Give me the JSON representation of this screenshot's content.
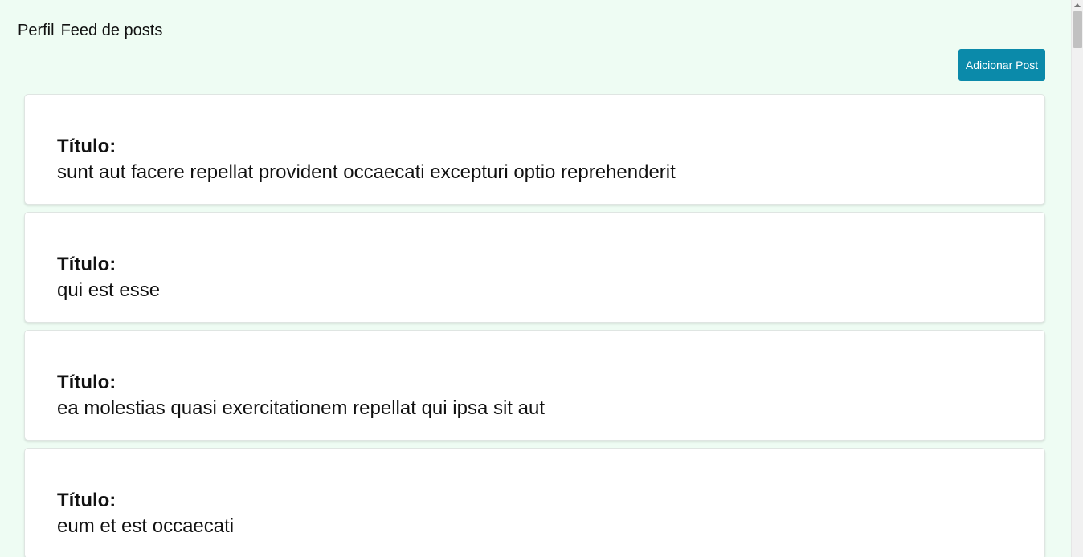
{
  "nav": {
    "profile_label": "Perfil",
    "feed_label": "Feed de posts"
  },
  "toolbar": {
    "add_post_label": "Adicionar Post"
  },
  "colors": {
    "page_background": "#eefcf3",
    "button_background": "#0b8aaa"
  },
  "posts": [
    {
      "label": "Título:",
      "title": "sunt aut facere repellat provident occaecati excepturi optio reprehenderit"
    },
    {
      "label": "Título:",
      "title": "qui est esse"
    },
    {
      "label": "Título:",
      "title": "ea molestias quasi exercitationem repellat qui ipsa sit aut"
    },
    {
      "label": "Título:",
      "title": "eum et est occaecati"
    }
  ]
}
